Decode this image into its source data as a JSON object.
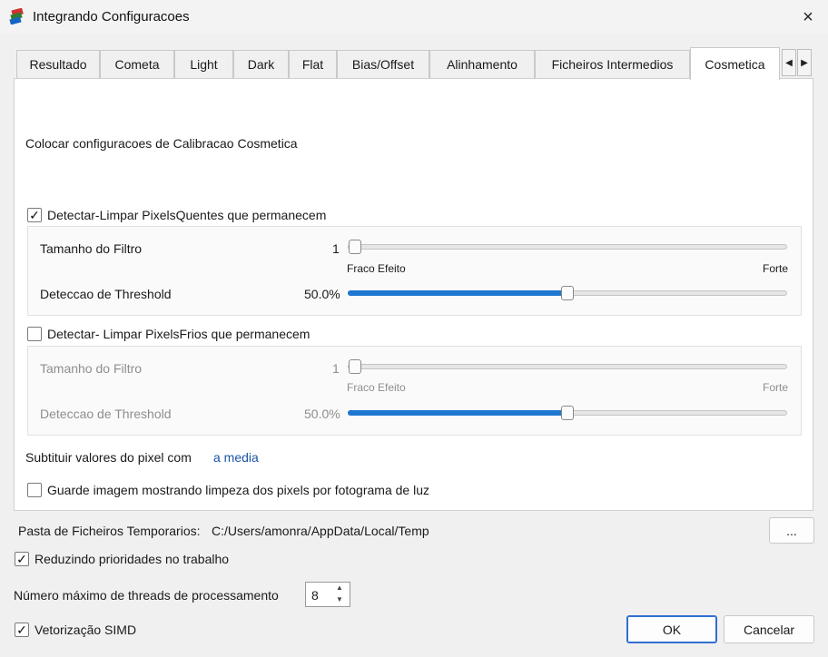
{
  "window": {
    "title": "Integrando Configuracoes",
    "close_icon": "×"
  },
  "tabs": [
    {
      "label": "Resultado"
    },
    {
      "label": "Cometa"
    },
    {
      "label": "Light"
    },
    {
      "label": "Dark"
    },
    {
      "label": "Flat"
    },
    {
      "label": "Bias/Offset"
    },
    {
      "label": "Alinhamento"
    },
    {
      "label": "Ficheiros Intermedios"
    },
    {
      "label": "Cosmetica",
      "active": true
    }
  ],
  "tab_scroll": {
    "left": "◀",
    "right": "▶"
  },
  "cosmetica": {
    "heading": "Colocar configuracoes de Calibracao Cosmetica",
    "hot": {
      "label": "Detectar-Limpar PixelsQuentes que permanecem",
      "checked": true,
      "check_glyph": "✓",
      "filter_label": "Tamanho do Filtro",
      "filter_value": "1",
      "filter_level": 0,
      "weak_label": "Fraco Efeito",
      "strong_label": "Forte",
      "threshold_label": "Deteccao de Threshold",
      "threshold_value": "50.0%",
      "threshold_level": 0.5
    },
    "cold": {
      "label": "Detectar- Limpar PixelsFrios que permanecem",
      "checked": false,
      "filter_label": "Tamanho do Filtro",
      "filter_value": "1",
      "filter_level": 0,
      "weak_label": "Fraco Efeito",
      "strong_label": "Forte",
      "threshold_label": "Deteccao de Threshold",
      "threshold_value": "50.0%",
      "threshold_level": 0.5
    },
    "replace_label": "Subtituir valores do pixel com",
    "replace_value": "a media",
    "save_label": "Guarde imagem mostrando limpeza dos pixels por fotograma de luz",
    "save_checked": false
  },
  "footer": {
    "temp_label": "Pasta de Ficheiros Temporarios:",
    "temp_path": "C:/Users/amonra/AppData/Local/Temp",
    "browse_label": "...",
    "reduce_label": "Reduzindo prioridades no trabalho",
    "reduce_checked": true,
    "threads_label": "Número máximo de threads de processamento",
    "threads_value": "8",
    "simd_label": "Vetorização SIMD",
    "simd_checked": true,
    "check_glyph": "✓",
    "ok_label": "OK",
    "cancel_label": "Cancelar",
    "spin_up": "▲",
    "spin_down": "▼"
  },
  "colors": {
    "accent": "#1e78d2",
    "link": "#1a55a8"
  }
}
